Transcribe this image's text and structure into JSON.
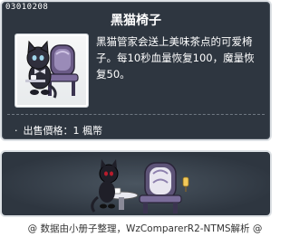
{
  "item": {
    "id": "03010208",
    "name": "黑猫椅子",
    "description": "黑猫管家会送上美味茶点的可爱椅子。每10秒血量恢复100，魔量恢复50。",
    "price": "出售價格：1 楓幣",
    "icon": "black-cat-butler-chair",
    "accent_color": "#2e3640",
    "border_color": "#dde1e5"
  },
  "footer": {
    "credit": "@ 数据由小册子整理，WzComparerR2-NTMS解析 @"
  }
}
